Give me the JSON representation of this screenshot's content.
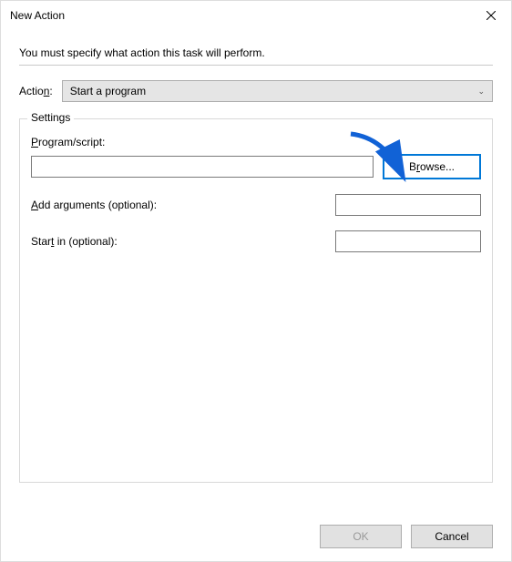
{
  "dialog": {
    "title": "New Action",
    "instruction": "You must specify what action this task will perform.",
    "action_label_prefix": "Actio",
    "action_label_u": "n",
    "action_label_suffix": ":",
    "action_value": "Start a program"
  },
  "settings": {
    "legend": "Settings",
    "program": {
      "label_u": "P",
      "label_rest": "rogram/script:",
      "value": ""
    },
    "browse": {
      "label_u": "r",
      "label_before": "B",
      "label_after": "owse..."
    },
    "args": {
      "label_u": "A",
      "label_rest": "dd arguments (optional):",
      "value": ""
    },
    "startin": {
      "label_before": "Star",
      "label_u": "t",
      "label_after": " in (optional):",
      "value": ""
    }
  },
  "buttons": {
    "ok": "OK",
    "cancel": "Cancel"
  }
}
